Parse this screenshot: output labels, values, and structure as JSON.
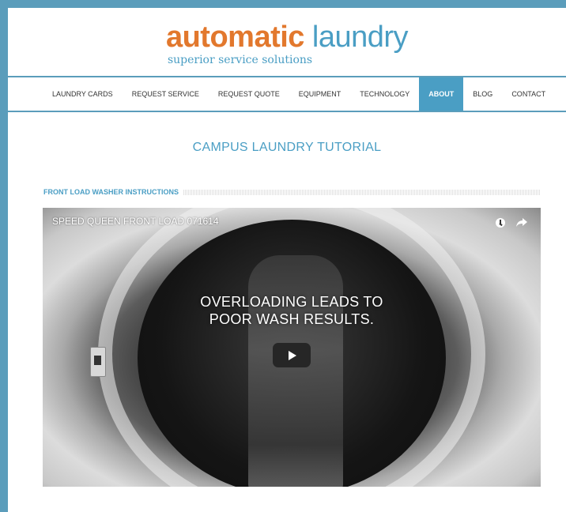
{
  "brand": {
    "name_part1": "automatic",
    "name_part2": "laundry",
    "tagline": "superior service solutions",
    "colors": {
      "orange": "#e2782d",
      "blue": "#4a9ec4"
    }
  },
  "nav": {
    "items": [
      {
        "label": "LAUNDRY CARDS",
        "active": false
      },
      {
        "label": "REQUEST SERVICE",
        "active": false
      },
      {
        "label": "REQUEST QUOTE",
        "active": false
      },
      {
        "label": "EQUIPMENT",
        "active": false
      },
      {
        "label": "TECHNOLOGY",
        "active": false
      },
      {
        "label": "ABOUT",
        "active": true
      },
      {
        "label": "BLOG",
        "active": false
      },
      {
        "label": "CONTACT",
        "active": false
      }
    ]
  },
  "main": {
    "title": "CAMPUS LAUNDRY TUTORIAL",
    "section_label": "FRONT LOAD WASHER INSTRUCTIONS",
    "video": {
      "title": "SPEED QUEEN FRONT LOAD 071614",
      "overlay_text": "OVERLOADING LEADS TO\nPOOR WASH RESULTS.",
      "icons": [
        "watch-later-icon",
        "share-icon",
        "play-icon"
      ]
    }
  }
}
